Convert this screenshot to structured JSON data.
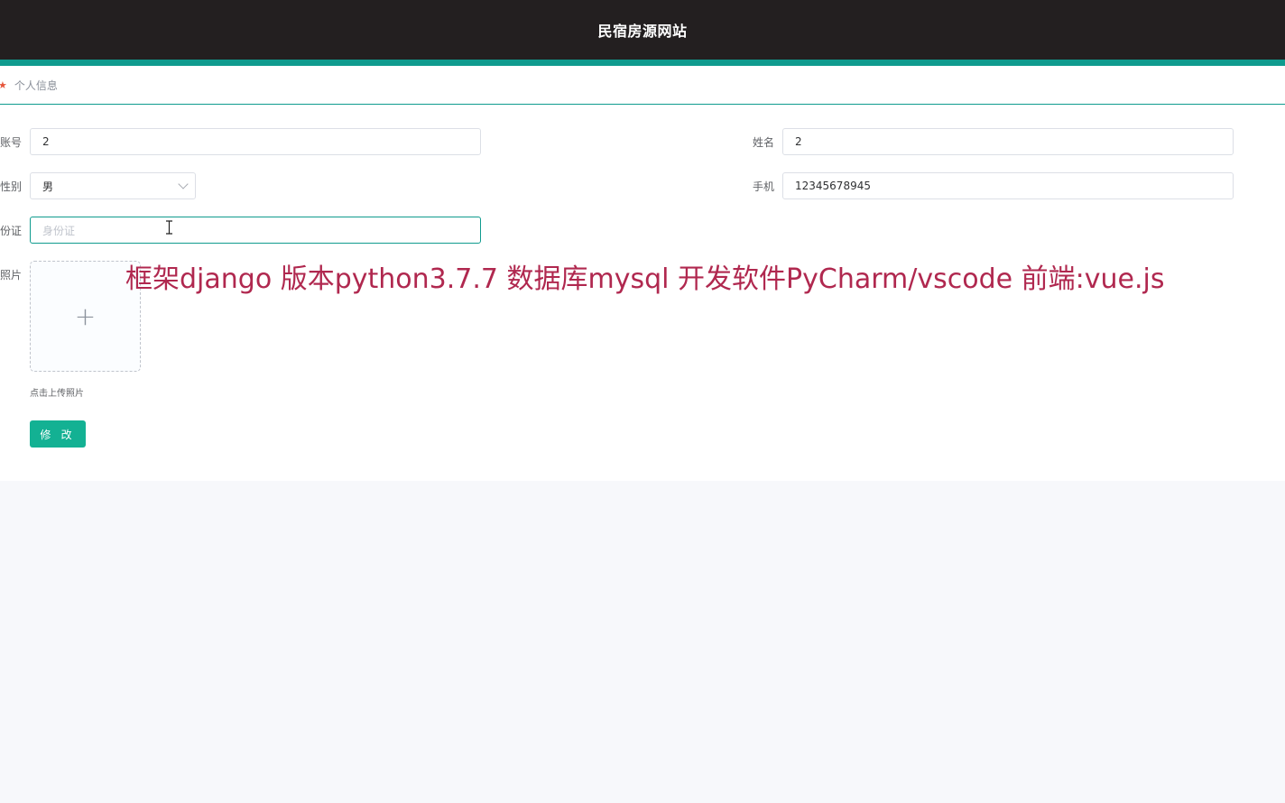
{
  "header": {
    "title": "民宿房源网站"
  },
  "breadcrumb": {
    "label": "个人信息"
  },
  "form": {
    "account": {
      "label": "账号",
      "value": "2"
    },
    "name": {
      "label": "姓名",
      "value": "2"
    },
    "gender": {
      "label": "性别",
      "value": "男"
    },
    "phone": {
      "label": "手机",
      "value": "12345678945"
    },
    "id_card": {
      "label": "份证",
      "placeholder": "身份证"
    },
    "photo": {
      "label": "照片",
      "upload_icon": "plus-icon",
      "tip": "点击上传照片"
    },
    "submit_label": "修 改"
  },
  "overlay_text": "框架django 版本python3.7.7 数据库mysql  开发软件PyCharm/vscode 前端:vue.js",
  "colors": {
    "topbar": "#231f20",
    "accent": "#0f9b8e",
    "button": "#13b193",
    "overlay": "#b0284f"
  }
}
